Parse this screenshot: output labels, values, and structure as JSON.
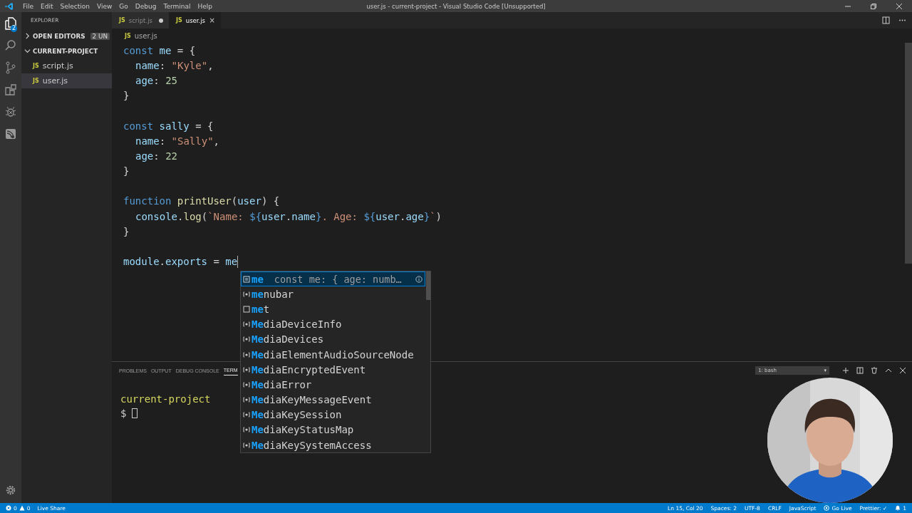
{
  "window": {
    "menu": [
      "File",
      "Edit",
      "Selection",
      "View",
      "Go",
      "Debug",
      "Terminal",
      "Help"
    ],
    "title": "user.js - current-project - Visual Studio Code [Unsupported]"
  },
  "activity_bar": {
    "explorer_badge": "2"
  },
  "sidebar": {
    "title": "EXPLORER",
    "sections": [
      {
        "label": "OPEN EDITORS",
        "badge": "2 UN",
        "expanded": false
      },
      {
        "label": "CURRENT-PROJECT",
        "expanded": true
      }
    ],
    "files": [
      {
        "icon": "JS",
        "name": "script.js",
        "selected": false
      },
      {
        "icon": "JS",
        "name": "user.js",
        "selected": true
      }
    ]
  },
  "tabs": [
    {
      "icon": "JS",
      "label": "script.js",
      "selected": false,
      "modified": true
    },
    {
      "icon": "JS",
      "label": "user.js",
      "selected": true,
      "modified": false,
      "close": "×"
    }
  ],
  "breadcrumb": {
    "icon": "JS",
    "label": "user.js"
  },
  "code": [
    {
      "kind": "code",
      "tokens": [
        {
          "kind": "keyword",
          "text": "const "
        },
        {
          "kind": "variable",
          "text": "me"
        },
        {
          "kind": "punct",
          "text": " = {"
        }
      ]
    },
    {
      "kind": "indented",
      "tokens": [
        {
          "kind": "variable",
          "text": "name"
        },
        {
          "kind": "punct",
          "text": ": "
        },
        {
          "kind": "string",
          "text": "\"Kyle\""
        },
        {
          "kind": "punct",
          "text": ","
        }
      ]
    },
    {
      "kind": "indented",
      "tokens": [
        {
          "kind": "variable",
          "text": "age"
        },
        {
          "kind": "punct",
          "text": ": "
        },
        {
          "kind": "number",
          "text": "25"
        }
      ]
    },
    {
      "kind": "code",
      "tokens": [
        {
          "kind": "punct",
          "text": "}"
        }
      ]
    },
    {
      "kind": "blank"
    },
    {
      "kind": "code",
      "tokens": [
        {
          "kind": "keyword",
          "text": "const "
        },
        {
          "kind": "variable",
          "text": "sally"
        },
        {
          "kind": "punct",
          "text": " = {"
        }
      ]
    },
    {
      "kind": "indented",
      "tokens": [
        {
          "kind": "variable",
          "text": "name"
        },
        {
          "kind": "punct",
          "text": ": "
        },
        {
          "kind": "string",
          "text": "\"Sally\""
        },
        {
          "kind": "punct",
          "text": ","
        }
      ]
    },
    {
      "kind": "indented",
      "tokens": [
        {
          "kind": "variable",
          "text": "age"
        },
        {
          "kind": "punct",
          "text": ": "
        },
        {
          "kind": "number",
          "text": "22"
        }
      ]
    },
    {
      "kind": "code",
      "tokens": [
        {
          "kind": "punct",
          "text": "}"
        }
      ]
    },
    {
      "kind": "blank"
    },
    {
      "kind": "code",
      "tokens": [
        {
          "kind": "keyword",
          "text": "function "
        },
        {
          "kind": "function",
          "text": "printUser"
        },
        {
          "kind": "punct",
          "text": "("
        },
        {
          "kind": "variable",
          "text": "user"
        },
        {
          "kind": "punct",
          "text": ") {"
        }
      ]
    },
    {
      "kind": "indented",
      "tokens": [
        {
          "kind": "variable",
          "text": "console"
        },
        {
          "kind": "punct",
          "text": "."
        },
        {
          "kind": "function",
          "text": "log"
        },
        {
          "kind": "punct",
          "text": "("
        },
        {
          "kind": "string",
          "text": "`Name: "
        },
        {
          "kind": "keyword",
          "text": "${"
        },
        {
          "kind": "variable",
          "text": "user"
        },
        {
          "kind": "punct",
          "text": "."
        },
        {
          "kind": "variable",
          "text": "name"
        },
        {
          "kind": "keyword",
          "text": "}"
        },
        {
          "kind": "string",
          "text": ". Age: "
        },
        {
          "kind": "keyword",
          "text": "${"
        },
        {
          "kind": "variable",
          "text": "user"
        },
        {
          "kind": "punct",
          "text": "."
        },
        {
          "kind": "variable",
          "text": "age"
        },
        {
          "kind": "keyword",
          "text": "}"
        },
        {
          "kind": "string",
          "text": "`"
        },
        {
          "kind": "punct",
          "text": ")"
        }
      ]
    },
    {
      "kind": "code",
      "tokens": [
        {
          "kind": "punct",
          "text": "}"
        }
      ]
    },
    {
      "kind": "blank"
    },
    {
      "kind": "code",
      "tokens": [
        {
          "kind": "variable",
          "text": "module"
        },
        {
          "kind": "punct",
          "text": "."
        },
        {
          "kind": "variable",
          "text": "exports"
        },
        {
          "kind": "punct",
          "text": " = "
        },
        {
          "kind": "variable",
          "text": "me"
        }
      ]
    }
  ],
  "suggestions": [
    {
      "kind": "field",
      "match": "me",
      "detail": "const me: { age: numb…",
      "selected": true
    },
    {
      "kind": "variable",
      "match": "me",
      "rest": "nubar",
      "selected": false
    },
    {
      "kind": "text",
      "match": "me",
      "rest": "t",
      "selected": false
    },
    {
      "kind": "variable",
      "match": "Me",
      "rest": "diaDeviceInfo",
      "selected": false
    },
    {
      "kind": "variable",
      "match": "Me",
      "rest": "diaDevices",
      "selected": false
    },
    {
      "kind": "variable",
      "match": "Me",
      "rest": "diaElementAudioSourceNode",
      "selected": false
    },
    {
      "kind": "variable",
      "match": "Me",
      "rest": "diaEncryptedEvent",
      "selected": false
    },
    {
      "kind": "variable",
      "match": "Me",
      "rest": "diaError",
      "selected": false
    },
    {
      "kind": "variable",
      "match": "Me",
      "rest": "diaKeyMessageEvent",
      "selected": false
    },
    {
      "kind": "variable",
      "match": "Me",
      "rest": "diaKeySession",
      "selected": false
    },
    {
      "kind": "variable",
      "match": "Me",
      "rest": "diaKeyStatusMap",
      "selected": false
    },
    {
      "kind": "variable",
      "match": "Me",
      "rest": "diaKeySystemAccess",
      "selected": false
    }
  ],
  "panel": {
    "tabs": [
      {
        "label": "PROBLEMS",
        "selected": false
      },
      {
        "label": "OUTPUT",
        "selected": false
      },
      {
        "label": "DEBUG CONSOLE",
        "selected": false
      },
      {
        "label": "TERM",
        "selected": true
      }
    ],
    "terminal_select": {
      "value": "1: bash",
      "caret": "▾"
    },
    "terminal": {
      "cwd": "current-project",
      "prompt": "$"
    }
  },
  "status_bar": {
    "errors": "0",
    "warnings": "0",
    "live_share": "Live Share",
    "right": [
      "Ln 15, Col 20",
      "Spaces: 2",
      "UTF-8",
      "CRLF",
      "JavaScript"
    ],
    "go_live": "Go Live",
    "prettier": "Prettier: ✓",
    "notifications": "1"
  }
}
